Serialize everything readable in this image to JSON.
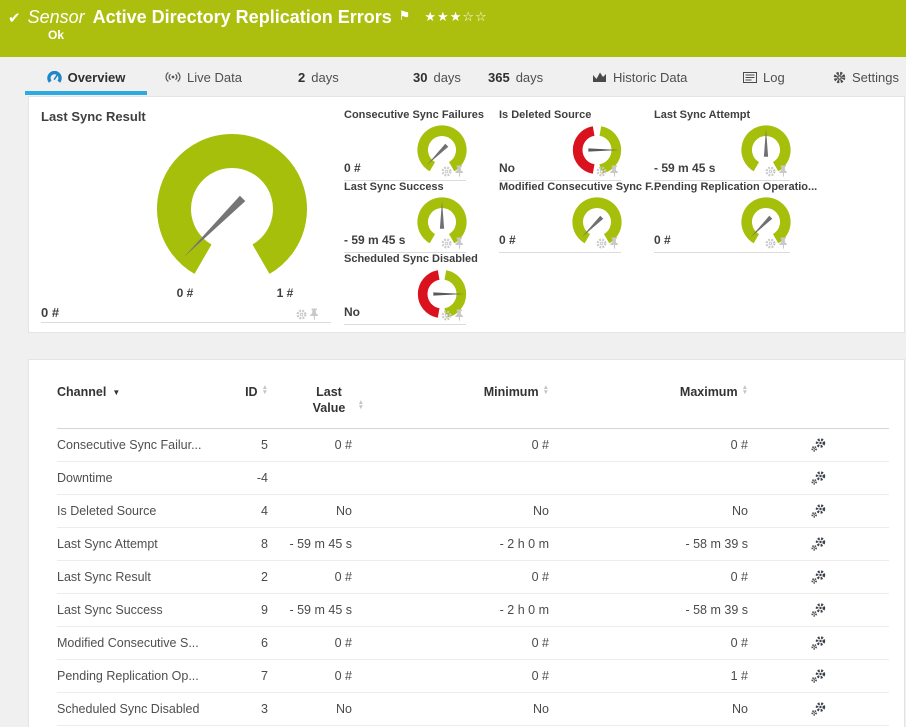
{
  "banner": {
    "kind_label": "Sensor",
    "title": "Active Directory Replication Errors",
    "status": "Ok",
    "rating": {
      "filled": 3,
      "total": 5
    }
  },
  "tabs": [
    {
      "label": "Overview",
      "icon": "gauge-icon",
      "active": true
    },
    {
      "label": "Live Data",
      "icon": "live-icon"
    },
    {
      "bold": "2",
      "label": "days"
    },
    {
      "bold": "30",
      "label": "days"
    },
    {
      "bold": "365",
      "label": "days"
    },
    {
      "label": "Historic Data",
      "icon": "chart-icon"
    },
    {
      "label": "Log",
      "icon": "log-icon"
    },
    {
      "label": "Settings",
      "icon": "gear-icon"
    }
  ],
  "gauges": {
    "primary": {
      "title": "Last Sync Result",
      "value": "0 #",
      "scale_min": "0 #",
      "scale_max": "1 #",
      "needle_angle_deg": 225
    },
    "small": [
      {
        "title": "Consecutive Sync Failures",
        "value": "0 #",
        "type": "green",
        "needle_angle_deg": 225
      },
      {
        "title": "Is Deleted Source",
        "value": "No",
        "type": "boolean",
        "needle_angle_deg": 0
      },
      {
        "title": "Last Sync Attempt",
        "value": "- 59 m 45 s",
        "type": "green",
        "needle_angle_deg": 90
      },
      {
        "title": "Last Sync Success",
        "value": "- 59 m 45 s",
        "type": "green",
        "needle_angle_deg": 90
      },
      {
        "title": "Modified Consecutive Sync F...",
        "value": "0 #",
        "type": "green",
        "needle_angle_deg": 225
      },
      {
        "title": "Pending Replication Operatio...",
        "value": "0 #",
        "type": "green",
        "needle_angle_deg": 225
      },
      {
        "title": "Scheduled Sync Disabled",
        "value": "No",
        "type": "boolean",
        "needle_angle_deg": 0
      }
    ]
  },
  "table": {
    "columns": [
      "Channel",
      "ID",
      "Last Value",
      "Minimum",
      "Maximum"
    ],
    "rows": [
      {
        "channel": "Consecutive Sync Failur...",
        "id": "5",
        "last": "0 #",
        "min": "0 #",
        "max": "0 #"
      },
      {
        "channel": "Downtime",
        "id": "-4",
        "last": "",
        "min": "",
        "max": ""
      },
      {
        "channel": "Is Deleted Source",
        "id": "4",
        "last": "No",
        "min": "No",
        "max": "No"
      },
      {
        "channel": "Last Sync Attempt",
        "id": "8",
        "last": "- 59 m 45 s",
        "min": "- 2 h 0 m",
        "max": "- 58 m 39 s"
      },
      {
        "channel": "Last Sync Result",
        "id": "2",
        "last": "0 #",
        "min": "0 #",
        "max": "0 #"
      },
      {
        "channel": "Last Sync Success",
        "id": "9",
        "last": "- 59 m 45 s",
        "min": "- 2 h 0 m",
        "max": "- 58 m 39 s"
      },
      {
        "channel": "Modified Consecutive S...",
        "id": "6",
        "last": "0 #",
        "min": "0 #",
        "max": "0 #"
      },
      {
        "channel": "Pending Replication Op...",
        "id": "7",
        "last": "0 #",
        "min": "0 #",
        "max": "1 #"
      },
      {
        "channel": "Scheduled Sync Disabled",
        "id": "3",
        "last": "No",
        "min": "No",
        "max": "No"
      }
    ]
  },
  "colors": {
    "banner_green": "#adbf0e",
    "gauge_green": "#a6bf0b",
    "gauge_red": "#d9121d",
    "tab_accent_blue": "#2fa9e1",
    "needle_gray": "#757575"
  }
}
